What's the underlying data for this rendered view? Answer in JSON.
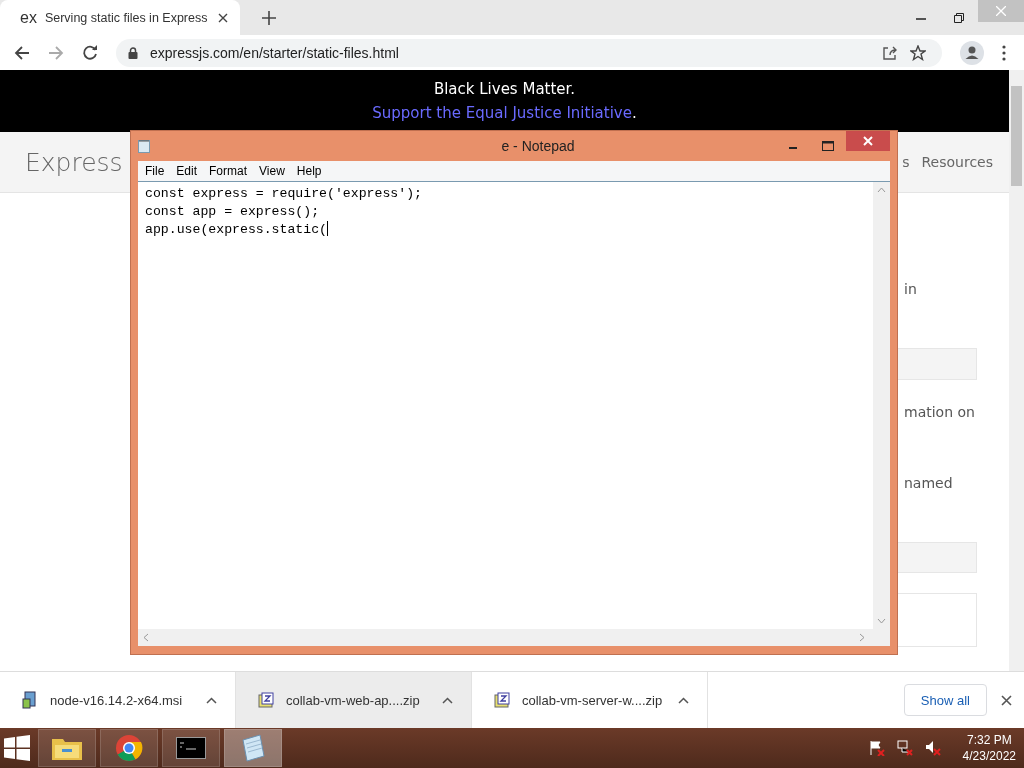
{
  "browser": {
    "tab": {
      "favicon": "ex",
      "title": "Serving static files in Express"
    },
    "url": "expressjs.com/en/starter/static-files.html"
  },
  "banner": {
    "headline": "Black Lives Matter.",
    "link": "Support the Equal Justice Initiative",
    "suffix": "."
  },
  "site": {
    "logo": "Express",
    "nav": [
      "s",
      "Resources"
    ],
    "fragments": [
      {
        "kind": "text",
        "text": "in"
      },
      {
        "kind": "box"
      },
      {
        "kind": "text",
        "text": "mation on"
      },
      {
        "kind": "text",
        "text": "named"
      },
      {
        "kind": "box"
      },
      {
        "kind": "code"
      }
    ]
  },
  "notepad": {
    "title": "e - Notepad",
    "menu": [
      "File",
      "Edit",
      "Format",
      "View",
      "Help"
    ],
    "lines": [
      "const express = require('express');",
      "const app = express();",
      "app.use(express.static("
    ]
  },
  "downloads": {
    "items": [
      {
        "kind": "msi",
        "name": "node-v16.14.2-x64.msi",
        "selected": false
      },
      {
        "kind": "zip",
        "name": "collab-vm-web-ap....zip",
        "selected": true
      },
      {
        "kind": "zip",
        "name": "collab-vm-server-w....zip",
        "selected": false
      }
    ],
    "show_all": "Show all"
  },
  "taskbar": {
    "apps": [
      {
        "kind": "explorer",
        "selected": false
      },
      {
        "kind": "chrome",
        "selected": false
      },
      {
        "kind": "cmd",
        "selected": false
      },
      {
        "kind": "notepad",
        "selected": true
      }
    ],
    "time": "7:32 PM",
    "date": "4/23/2022"
  }
}
